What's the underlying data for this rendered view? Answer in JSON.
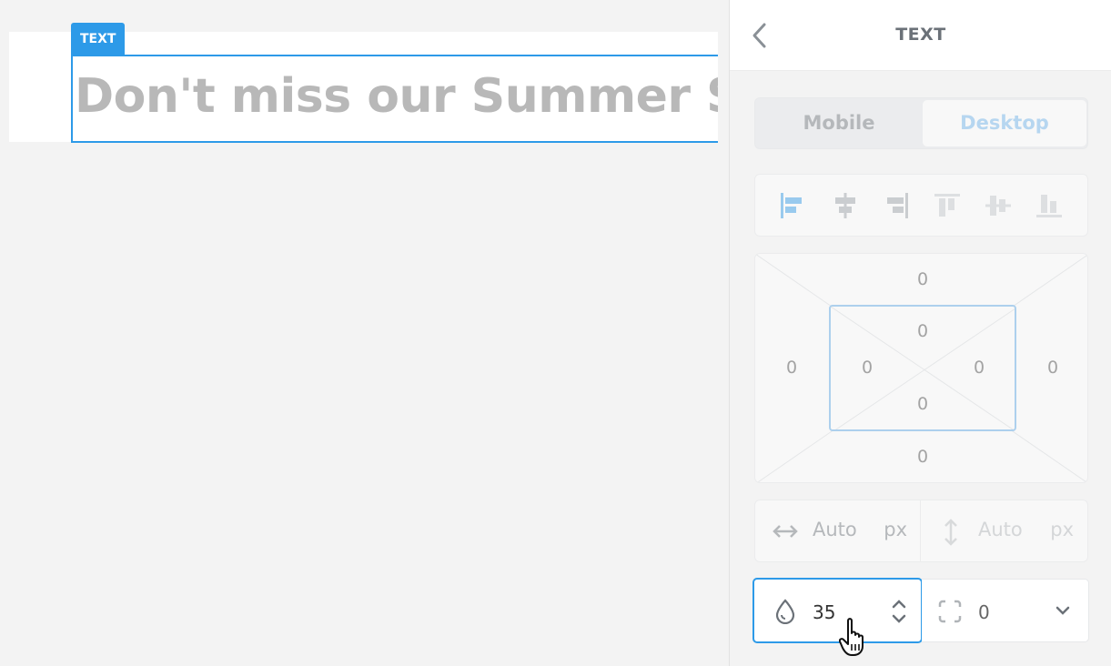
{
  "canvas": {
    "element_tag": "TEXT",
    "text_content": "Don't miss our Summer Sale"
  },
  "panel": {
    "title": "TEXT",
    "back_icon": "chevron-left-icon",
    "device_tabs": [
      {
        "label": "Mobile",
        "active": false
      },
      {
        "label": "Desktop",
        "active": true
      }
    ],
    "alignment_icons": [
      "align-left-icon",
      "align-center-horizontal-icon",
      "align-right-icon",
      "align-top-icon",
      "align-center-vertical-icon",
      "align-bottom-icon"
    ],
    "spacing": {
      "margin": {
        "top": "0",
        "right": "0",
        "bottom": "0",
        "left": "0"
      },
      "padding": {
        "top": "0",
        "right": "0",
        "bottom": "0",
        "left": "0"
      }
    },
    "size": {
      "width": {
        "value": "Auto",
        "unit": "px"
      },
      "height": {
        "value": "Auto",
        "unit": "px"
      }
    },
    "opacity": {
      "value": "35",
      "icon": "drop-icon"
    },
    "border_radius": {
      "value": "0",
      "icon": "corner-radius-icon"
    }
  },
  "colors": {
    "accent": "#2d9ae8",
    "muted_text": "#b8b8b8",
    "panel_bg": "#f3f3f3"
  }
}
